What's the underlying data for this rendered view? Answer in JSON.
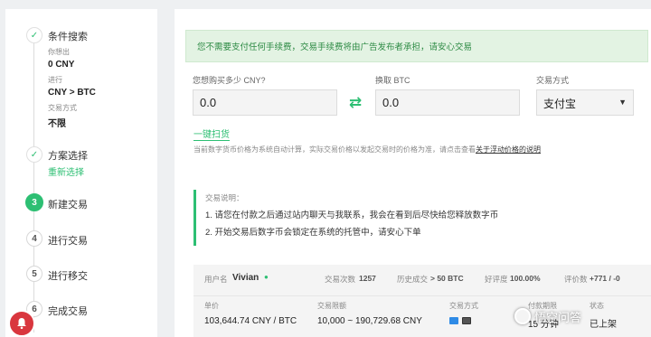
{
  "steps": {
    "s1": {
      "title": "条件搜索",
      "lbl_pay": "你想出",
      "val_pay": "0 CNY",
      "lbl_pair": "进行",
      "val_pair": "CNY > BTC",
      "lbl_method": "交易方式",
      "val_method": "不限"
    },
    "s2": {
      "title": "方案选择",
      "reselect": "重新选择"
    },
    "s3": {
      "num": "3",
      "title": "新建交易"
    },
    "s4": {
      "num": "4",
      "title": "进行交易"
    },
    "s5": {
      "num": "5",
      "title": "进行移交"
    },
    "s6": {
      "num": "6",
      "title": "完成交易"
    },
    "check": "✓"
  },
  "notice": "您不需要支付任何手续费，交易手续费将由广告发布者承担，请安心交易",
  "form": {
    "cny_label": "您想购买多少 CNY?",
    "cny_value": "0.0",
    "btc_label": "换取 BTC",
    "btc_value": "0.0",
    "method_label": "交易方式",
    "method_value": "支付宝",
    "swap_icon": "⇄"
  },
  "scan_link": "一键扫货",
  "price_note": "当前数字货币价格为系统自动计算，实际交易价格以发起交易时的价格为准，请点击查看",
  "price_note_link": "关于浮动价格的说明",
  "instructions": {
    "title": "交易说明：",
    "items": [
      "1. 请您在付款之后通过站内聊天与我联系，我会在看到后尽快给您释放数字币",
      "2. 开始交易后数字币会锁定在系统的托管中，请安心下单"
    ]
  },
  "trader": {
    "user_label": "用户名",
    "username": "Vivian",
    "trades_label": "交易次数",
    "trades": "1257",
    "history_label": "历史成交",
    "history": "> 50 BTC",
    "rating_label": "好评度",
    "rating": "100.00%",
    "score_label": "评价数",
    "score": "+771 / -0",
    "headers": {
      "price": "单价",
      "limit": "交易限额",
      "method": "交易方式",
      "time": "付款期限",
      "status": "状态"
    },
    "row": {
      "price": "103,644.74 CNY / BTC",
      "limit": "10,000 ~ 190,729.68 CNY",
      "time": "15 分钟",
      "status": "已上架"
    }
  },
  "watermark": "悟空问答",
  "colors": {
    "accent": "#2dbf73",
    "notice_bg": "#e3f3e3",
    "bell": "#d9363e"
  }
}
